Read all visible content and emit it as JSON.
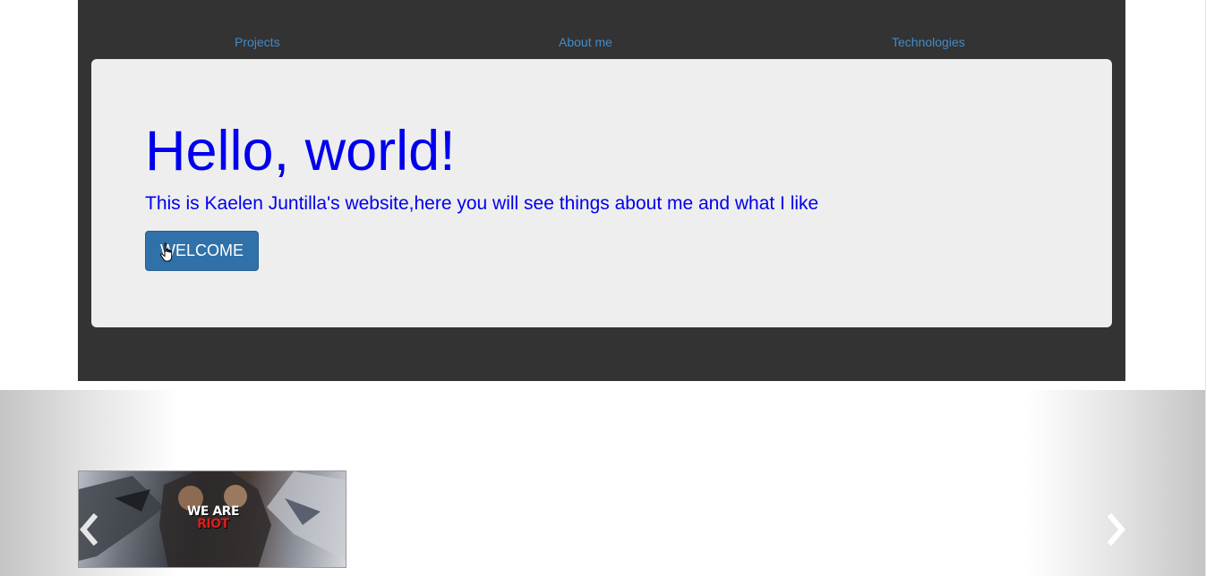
{
  "nav": {
    "projects": "Projects",
    "about": "About me",
    "technologies": "Technologies"
  },
  "jumbotron": {
    "title": "Hello, world!",
    "text": "This is Kaelen Juntilla's website,here you will see things about me and what I like",
    "button_label": "WELCOME"
  },
  "carousel": {
    "slide_logo_line1": "WE ARE",
    "slide_logo_line2": "RIOT",
    "prev_icon": "chevron-left-icon",
    "next_icon": "chevron-right-icon"
  },
  "colors": {
    "header_bg": "#333333",
    "jumbotron_bg": "#eeeeee",
    "link": "#428bca",
    "heading_text": "#0000ee",
    "button": "#3071a9"
  }
}
